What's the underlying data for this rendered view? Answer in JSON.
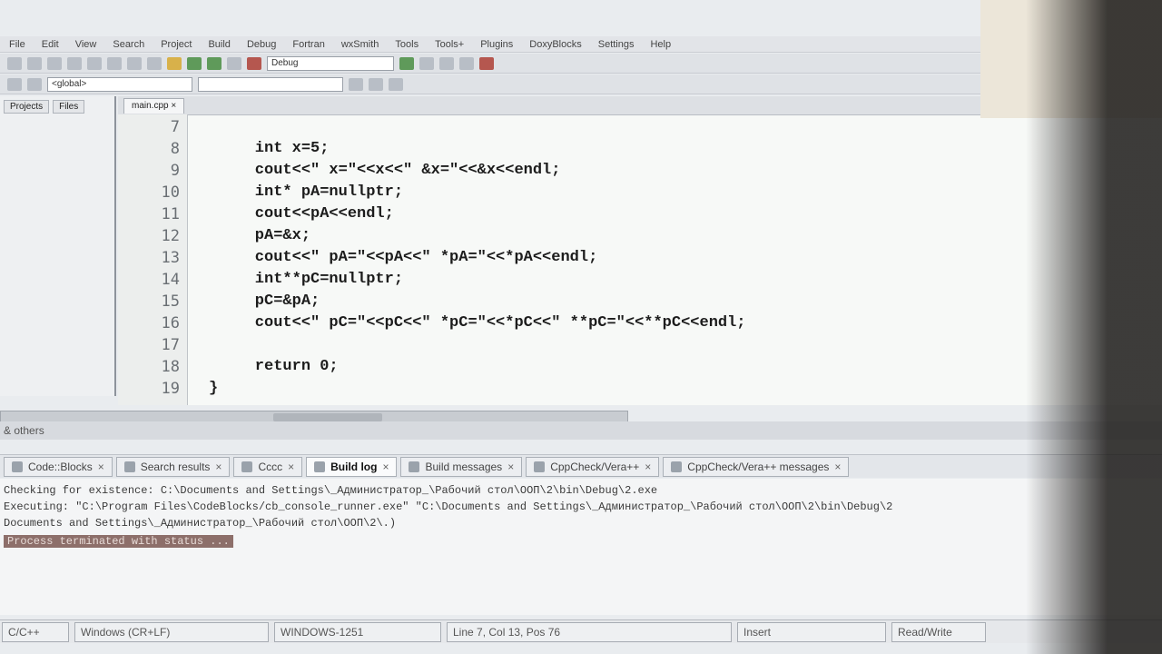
{
  "menu": [
    "File",
    "Edit",
    "View",
    "Search",
    "Project",
    "Build",
    "Debug",
    "Fortran",
    "wxSmith",
    "Tools",
    "Tools+",
    "Plugins",
    "DoxyBlocks",
    "Settings",
    "Help"
  ],
  "toolbar": {
    "target_combo": "Debug",
    "scope_combo": "<global>"
  },
  "management": {
    "tabs": [
      "Projects",
      "Files"
    ]
  },
  "editor": {
    "tab": "main.cpp",
    "line_numbers": [
      "7",
      "8",
      "9",
      "10",
      "11",
      "12",
      "13",
      "14",
      "15",
      "16",
      "17",
      "18",
      "19"
    ],
    "lines": [
      "",
      "    int x=5;",
      "    cout<<\" x=\"<<x<<\" &x=\"<<&x<<endl;",
      "    int* pA=nullptr;",
      "    cout<<pA<<endl;",
      "    pA=&x;",
      "    cout<<\" pA=\"<<pA<<\" *pA=\"<<*pA<<endl;",
      "    int**pC=nullptr;",
      "    pC=&pA;",
      "    cout<<\" pC=\"<<pC<<\" *pC=\"<<*pC<<\" **pC=\"<<**pC<<endl;",
      "",
      "    return 0;",
      "}"
    ]
  },
  "others_bar": "& others",
  "logs": {
    "tabs": [
      {
        "label": "Code::Blocks",
        "active": false
      },
      {
        "label": "Search results",
        "active": false
      },
      {
        "label": "Cccc",
        "active": false
      },
      {
        "label": "Build log",
        "active": true
      },
      {
        "label": "Build messages",
        "active": false
      },
      {
        "label": "CppCheck/Vera++",
        "active": false
      },
      {
        "label": "CppCheck/Vera++ messages",
        "active": false
      }
    ],
    "lines": [
      "Checking for existence: C:\\Documents and Settings\\_Администратор_\\Рабочий стол\\ООП\\2\\bin\\Debug\\2.exe",
      "Executing: \"C:\\Program Files\\CodeBlocks/cb_console_runner.exe\" \"C:\\Documents and Settings\\_Администратор_\\Рабочий стол\\ООП\\2\\bin\\Debug\\2",
      "Documents and Settings\\_Администратор_\\Рабочий стол\\ООП\\2\\.)",
      "Process terminated with status ..."
    ]
  },
  "statusbar": [
    "C/C++",
    "Windows (CR+LF)",
    "WINDOWS-1251",
    "Line 7, Col 13, Pos 76",
    "Insert",
    "Read/Write"
  ]
}
